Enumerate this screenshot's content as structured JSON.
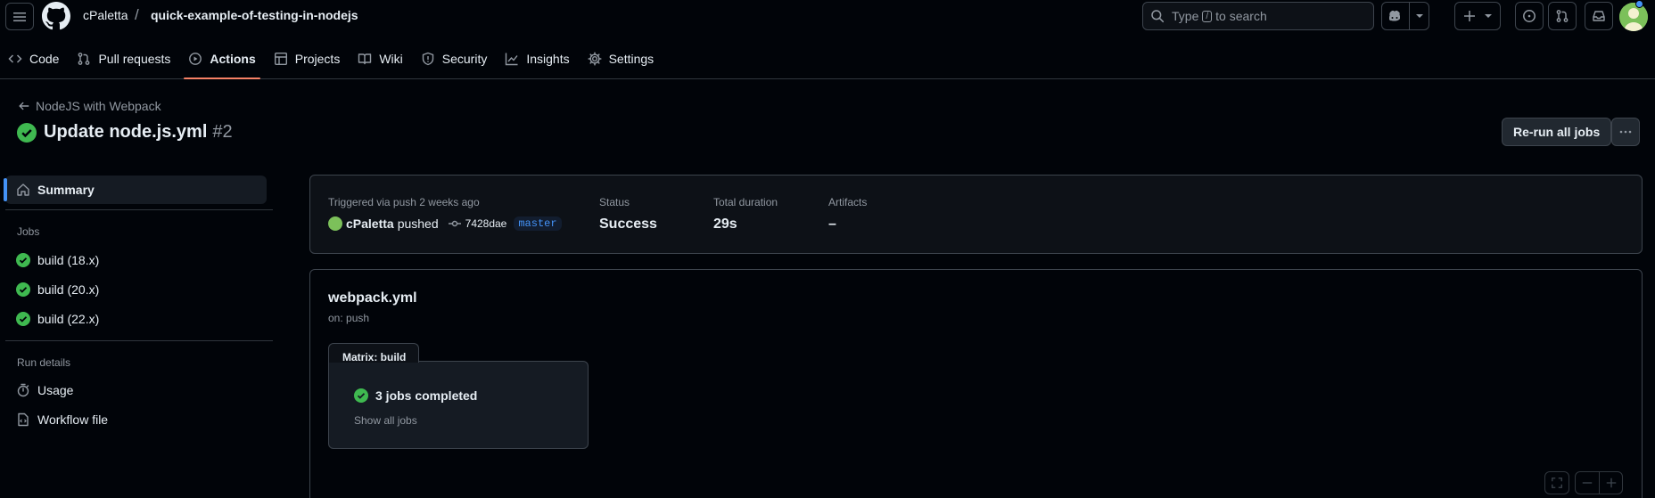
{
  "header": {
    "owner": "cPaletta",
    "separator": "/",
    "repo": "quick-example-of-testing-in-nodejs",
    "search_prefix": "Type",
    "search_key": "/",
    "search_suffix": "to search"
  },
  "tabs": [
    {
      "label": "Code",
      "icon": "code-icon"
    },
    {
      "label": "Pull requests",
      "icon": "pull-request-icon"
    },
    {
      "label": "Actions",
      "icon": "play-icon",
      "selected": true
    },
    {
      "label": "Projects",
      "icon": "table-icon"
    },
    {
      "label": "Wiki",
      "icon": "book-icon"
    },
    {
      "label": "Security",
      "icon": "shield-icon"
    },
    {
      "label": "Insights",
      "icon": "graph-icon"
    },
    {
      "label": "Settings",
      "icon": "gear-icon"
    }
  ],
  "run": {
    "workflow": "NodeJS with Webpack",
    "name": "Update node.js.yml",
    "number": "#2",
    "rerun_label": "Re-run all jobs"
  },
  "sidebar": {
    "summary": "Summary",
    "jobs_heading": "Jobs",
    "jobs": [
      "build (18.x)",
      "build (20.x)",
      "build (22.x)"
    ],
    "run_details_heading": "Run details",
    "usage": "Usage",
    "workflow_file": "Workflow file"
  },
  "summary": {
    "triggered": "Triggered via push 2 weeks ago",
    "actor": "cPaletta",
    "action": "pushed",
    "commit": "7428dae",
    "branch": "master",
    "status_label": "Status",
    "status": "Success",
    "duration_label": "Total duration",
    "duration": "29s",
    "artifacts_label": "Artifacts",
    "artifacts": "–"
  },
  "graph": {
    "workflow_file": "webpack.yml",
    "trigger": "on: push",
    "matrix_label": "Matrix: build",
    "jobs_completed": "3 jobs completed",
    "show_all": "Show all jobs"
  },
  "colors": {
    "success": "#3fb950",
    "accent": "#4493f8",
    "underline": "#f78166"
  }
}
